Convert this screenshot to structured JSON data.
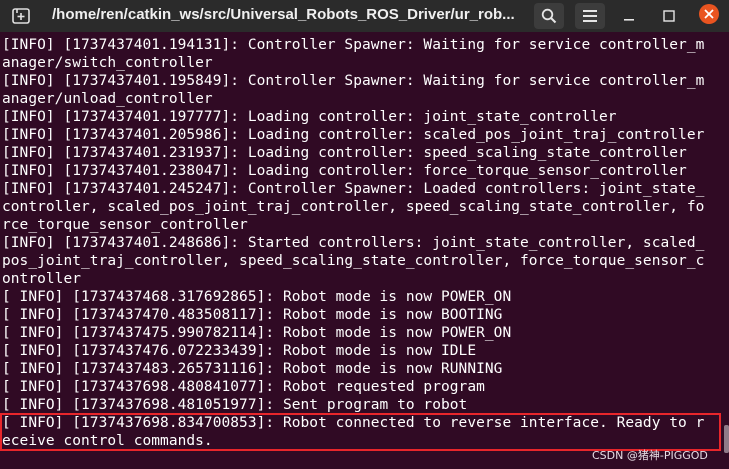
{
  "window": {
    "title": "/home/ren/catkin_ws/src/Universal_Robots_ROS_Driver/ur_rob...",
    "icons": {
      "new_tab": "new-tab-icon",
      "search": "search-icon",
      "menu": "hamburger-menu-icon",
      "minimize": "minimize-icon",
      "maximize": "maximize-icon",
      "close": "close-icon"
    },
    "colors": {
      "terminal_background": "#300a24",
      "titlebar": "#2b2b2b",
      "close_button": "#e95420",
      "highlight_border": "#e8262b"
    }
  },
  "terminal": {
    "lines": [
      "[INFO] [1737437401.194131]: Controller Spawner: Waiting for service controller_m",
      "anager/switch_controller",
      "[INFO] [1737437401.195849]: Controller Spawner: Waiting for service controller_m",
      "anager/unload_controller",
      "[INFO] [1737437401.197777]: Loading controller: joint_state_controller",
      "[INFO] [1737437401.205986]: Loading controller: scaled_pos_joint_traj_controller",
      "[INFO] [1737437401.231937]: Loading controller: speed_scaling_state_controller",
      "[INFO] [1737437401.238047]: Loading controller: force_torque_sensor_controller",
      "[INFO] [1737437401.245247]: Controller Spawner: Loaded controllers: joint_state_",
      "controller, scaled_pos_joint_traj_controller, speed_scaling_state_controller, fo",
      "rce_torque_sensor_controller",
      "[INFO] [1737437401.248686]: Started controllers: joint_state_controller, scaled_",
      "pos_joint_traj_controller, speed_scaling_state_controller, force_torque_sensor_c",
      "ontroller",
      "[ INFO] [1737437468.317692865]: Robot mode is now POWER_ON",
      "[ INFO] [1737437470.483508117]: Robot mode is now BOOTING",
      "[ INFO] [1737437475.990782114]: Robot mode is now POWER_ON",
      "[ INFO] [1737437476.072233439]: Robot mode is now IDLE",
      "[ INFO] [1737437483.265731116]: Robot mode is now RUNNING",
      "[ INFO] [1737437698.480841077]: Robot requested program",
      "[ INFO] [1737437698.481051977]: Sent program to robot",
      "[ INFO] [1737437698.834700853]: Robot connected to reverse interface. Ready to r",
      "eceive control commands."
    ]
  },
  "watermark": "CSDN @猪神-PIGGOD"
}
